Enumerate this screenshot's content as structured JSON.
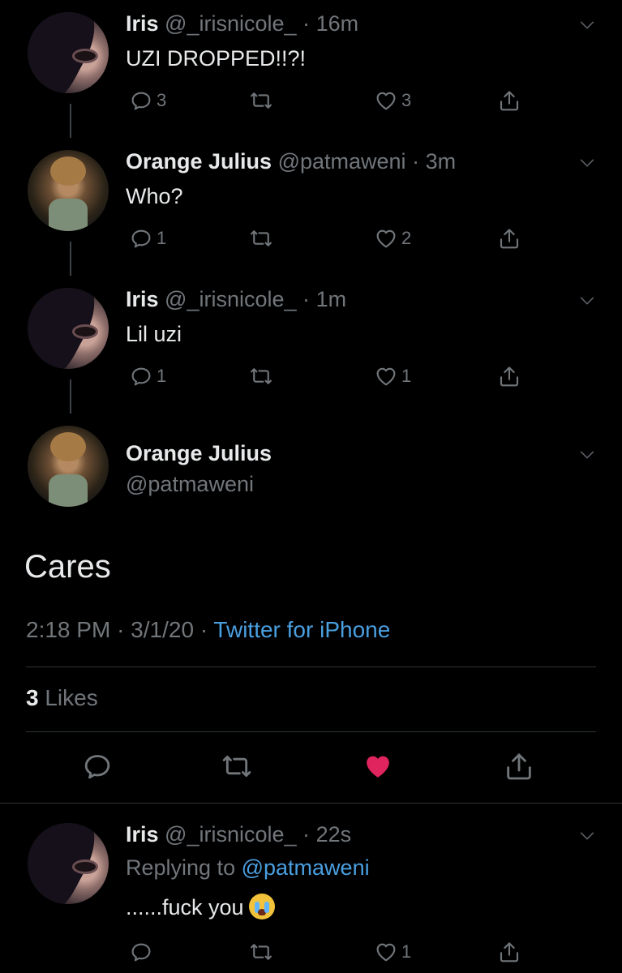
{
  "thread": [
    {
      "name": "Iris",
      "handle": "@_irisnicole_",
      "time": "16m",
      "text": "UZI DROPPED!!?!",
      "replies": "3",
      "retweets": "",
      "likes": "3"
    },
    {
      "name": "Orange Julius",
      "handle": "@patmaweni",
      "time": "3m",
      "text": "Who?",
      "replies": "1",
      "retweets": "",
      "likes": "2"
    },
    {
      "name": "Iris",
      "handle": "@_irisnicole_",
      "time": "1m",
      "text": "Lil uzi",
      "replies": "1",
      "retweets": "",
      "likes": "1"
    }
  ],
  "main": {
    "name": "Orange Julius",
    "handle": "@patmaweni",
    "text": "Cares",
    "time": "2:18 PM",
    "date": "3/1/20",
    "source": "Twitter for iPhone",
    "likes_count": "3",
    "likes_label": "Likes",
    "like_color": "#e0245e"
  },
  "reply": {
    "name": "Iris",
    "handle": "@_irisnicole_",
    "time": "22s",
    "replying_prefix": "Replying to",
    "replying_to": "@patmaweni",
    "text": "......fuck you",
    "likes": "1"
  },
  "icons": {
    "reply": "reply-icon",
    "retweet": "retweet-icon",
    "like": "heart-icon",
    "share": "share-icon",
    "more": "chevron-down-icon",
    "emoji": "loudly-crying-face-emoji"
  },
  "separator": "·"
}
